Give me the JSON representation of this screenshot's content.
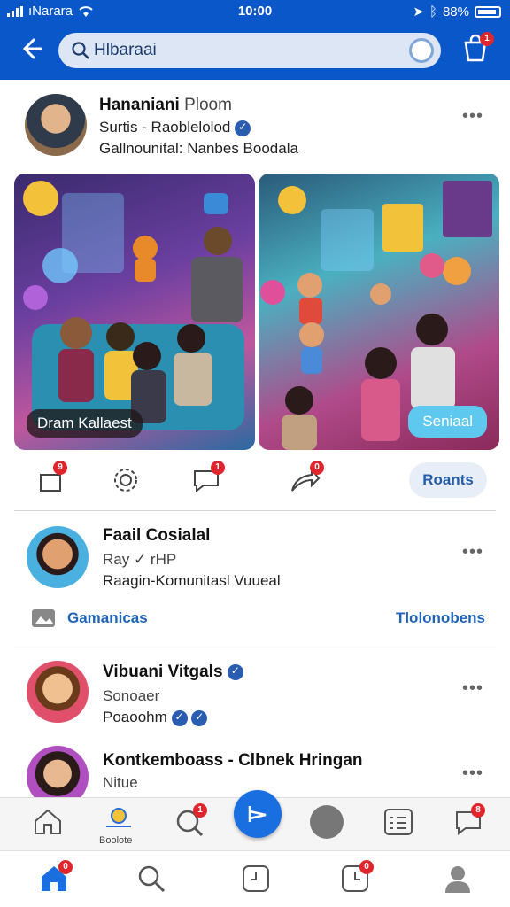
{
  "status": {
    "carrier": "ıNarara",
    "time": "10:00",
    "battery": "88%"
  },
  "header": {
    "search_text": "Hlbaraai",
    "cart_badge": "1"
  },
  "post": {
    "name": "Hananiani",
    "name_suffix": "Ploom",
    "line2": "Surtis - Raoblelolod",
    "line3": "Gallnounital: Nanbes Boodala",
    "more": "•••",
    "card1_caption": "Dram Kallaest",
    "card2_button": "Seniaal",
    "actions": {
      "like_badge": "9",
      "comment_badge": "1",
      "share_badge": "0",
      "button": "Roants"
    }
  },
  "item2": {
    "name": "Faail Cosialal",
    "line2": "Ray ✓ rHP",
    "line3": "Raagin-Komunitasl Vuueal",
    "more": "•••",
    "link_left": "Gamanicas",
    "link_right": "Tlolonobens"
  },
  "item3": {
    "name": "Vibuani Vitgals",
    "line2": "Sonoaer",
    "line3": "Poaoohm",
    "more": "•••"
  },
  "item4": {
    "name": "Kontkemboass - Clbnek Hringan",
    "line2": "Nitue",
    "more": "•••"
  },
  "iconbar": {
    "label": "Boolote",
    "badge_a": "1",
    "badge_b": "8"
  },
  "navbar": {
    "home_badge": "0",
    "clock_badge": "0"
  },
  "colors": {
    "brand": "#0a57c9",
    "accent": "#1a6fe0",
    "badge": "#e0262d"
  }
}
